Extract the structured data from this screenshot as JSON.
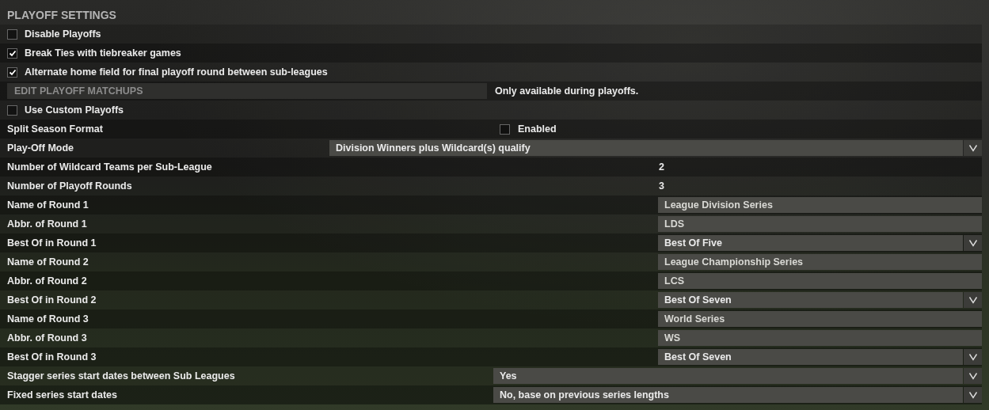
{
  "section_title": "PLAYOFF SETTINGS",
  "rows": [
    {
      "kind": "checkbox",
      "label": "Disable Playoffs",
      "checked": false
    },
    {
      "kind": "checkbox",
      "label": "Break Ties with tiebreaker games",
      "checked": true
    },
    {
      "kind": "checkbox",
      "label": "Alternate home field for final playoff round between sub-leagues",
      "checked": true
    },
    {
      "kind": "button",
      "label": "EDIT PLAYOFF MATCHUPS",
      "disabled": true,
      "note": "Only available during playoffs."
    },
    {
      "kind": "checkbox",
      "label": "Use Custom Playoffs",
      "checked": false
    },
    {
      "kind": "toggle",
      "label": "Split Season Format",
      "option": "Enabled",
      "checked": false
    },
    {
      "kind": "wide-select",
      "label": "Play-Off Mode",
      "value": "Division Winners plus Wildcard(s) qualify"
    },
    {
      "kind": "number",
      "label": "Number of Wildcard Teams per Sub-League",
      "value": "2"
    },
    {
      "kind": "number",
      "label": "Number of Playoff Rounds",
      "value": "3"
    },
    {
      "kind": "text",
      "label": "Name of Round 1",
      "value": "League Division Series"
    },
    {
      "kind": "text",
      "label": "Abbr. of Round 1",
      "value": "LDS"
    },
    {
      "kind": "select",
      "label": "Best Of in Round 1",
      "value": "Best Of Five"
    },
    {
      "kind": "text",
      "label": "Name of Round 2",
      "value": "League Championship Series"
    },
    {
      "kind": "text",
      "label": "Abbr. of Round 2",
      "value": "LCS"
    },
    {
      "kind": "select",
      "label": "Best Of in Round 2",
      "value": "Best Of Seven"
    },
    {
      "kind": "text",
      "label": "Name of Round 3",
      "value": "World Series"
    },
    {
      "kind": "text",
      "label": "Abbr. of Round 3",
      "value": "WS"
    },
    {
      "kind": "select",
      "label": "Best Of in Round 3",
      "value": "Best Of Seven"
    },
    {
      "kind": "half-select",
      "label": "Stagger series start dates between Sub Leagues",
      "value": "Yes"
    },
    {
      "kind": "half-select",
      "label": "Fixed series start dates",
      "value": "No, base on previous series lengths"
    }
  ]
}
